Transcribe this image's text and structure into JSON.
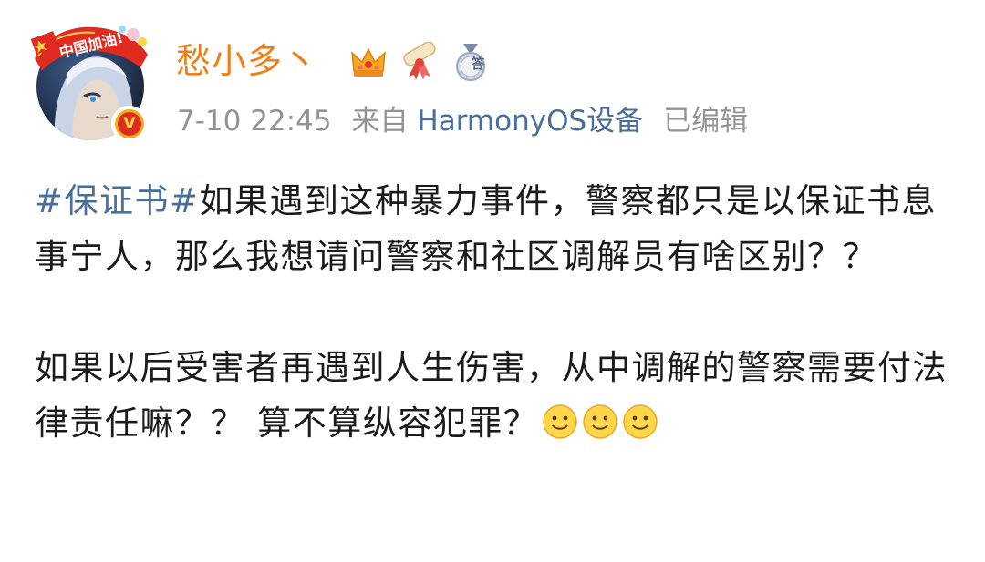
{
  "post": {
    "username": "愁小多丶",
    "avatar_frame_text": "中国加油!",
    "verified_mark": "V",
    "badges": [
      "crown-badge-icon",
      "scroll-bow-badge-icon",
      "answer-medal-icon"
    ],
    "answer_medal_char": "答",
    "timestamp": "7-10 22:45",
    "source_prefix": "来自",
    "device": "HarmonyOS设备",
    "edited_label": "已编辑",
    "topic": "#保证书#",
    "paragraph1": "如果遇到这种暴力事件，警察都只是以保证书息事宁人，那么我想请问警察和社区调解员有啥区别？？",
    "paragraph2": "如果以后受害者再遇到人生伤害，从中调解的警察需要付法律责任嘛？？ 算不算纵容犯罪？",
    "emoji_count": 3,
    "emoji_name": "smile-emoji"
  },
  "colors": {
    "username": "#f07e16",
    "link": "#4a6e9a",
    "meta": "#939393",
    "body_text": "#1b1b1b",
    "badge_red": "#e02b20",
    "badge_gold": "#e8b21e"
  }
}
